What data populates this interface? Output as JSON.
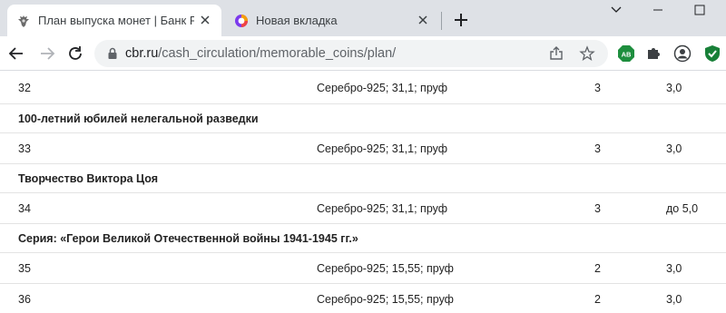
{
  "browser": {
    "tabs": [
      {
        "title": "План выпуска монет | Банк Рос",
        "active": true,
        "icon": "bank-of-russia-eagle-icon"
      },
      {
        "title": "Новая вкладка",
        "active": false,
        "icon": "yandex-browser-icon"
      }
    ],
    "address": {
      "host": "cbr.ru",
      "path": "/cash_circulation/memorable_coins/plan/"
    },
    "extensions": [
      "adblock-icon",
      "extensions-puzzle-icon",
      "profile-icon",
      "shield-icon"
    ]
  },
  "table": {
    "rows": [
      {
        "type": "item",
        "number": "32",
        "metal": "Серебро-925; 31,1; пруф",
        "quantity": "3",
        "edition": "3,0"
      },
      {
        "type": "header",
        "title": "100-летний юбилей нелегальной разведки"
      },
      {
        "type": "item",
        "number": "33",
        "metal": "Серебро-925; 31,1; пруф",
        "quantity": "3",
        "edition": "3,0"
      },
      {
        "type": "header",
        "title": "Творчество Виктора Цоя"
      },
      {
        "type": "item",
        "number": "34",
        "metal": "Серебро-925; 31,1; пруф",
        "quantity": "3",
        "edition": "до 5,0"
      },
      {
        "type": "header",
        "title": "Серия: «Герои Великой Отечественной войны 1941-1945 гг.»"
      },
      {
        "type": "item",
        "number": "35",
        "metal": "Серебро-925; 15,55; пруф",
        "quantity": "2",
        "edition": "3,0"
      },
      {
        "type": "item",
        "number": "36",
        "metal": "Серебро-925; 15,55; пруф",
        "quantity": "2",
        "edition": "3,0"
      }
    ]
  }
}
